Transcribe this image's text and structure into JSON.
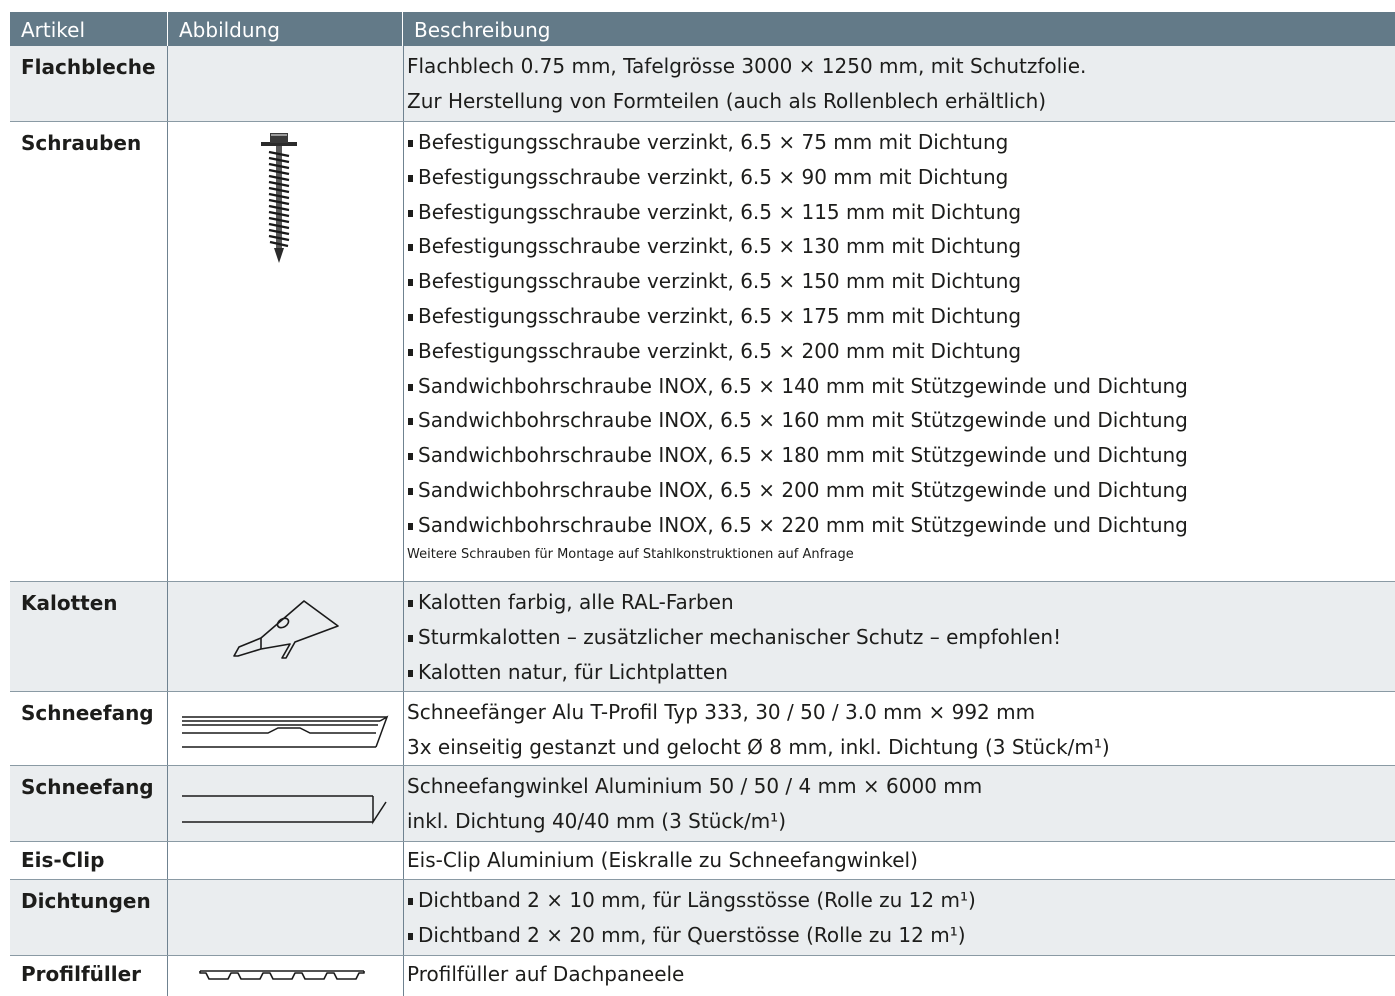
{
  "header": {
    "col1": "Artikel",
    "col2": "Abbildung",
    "col3": "Beschreibung"
  },
  "rows": [
    {
      "article": "Flachbleche",
      "icon": "",
      "lines": [
        "Flachblech 0.75 mm, Tafelgrösse 3000 × 1250 mm, mit Schutzfolie.",
        "Zur Herstellung von Formteilen (auch als Rollenblech erhältlich)"
      ]
    },
    {
      "article": "Schrauben",
      "icon": "screw-icon",
      "lines": [
        "Befestigungsschraube verzinkt, 6.5 ×   75 mm mit Dichtung",
        "Befestigungsschraube verzinkt, 6.5 ×   90 mm mit Dichtung",
        "Befestigungsschraube verzinkt, 6.5 × 115 mm mit Dichtung",
        "Befestigungsschraube verzinkt, 6.5 × 130 mm mit Dichtung",
        "Befestigungsschraube verzinkt, 6.5 × 150 mm mit Dichtung",
        "Befestigungsschraube verzinkt, 6.5 × 175 mm mit Dichtung",
        "Befestigungsschraube verzinkt, 6.5 × 200 mm mit Dichtung",
        "Sandwichbohrschraube INOX, 6.5 × 140 mm mit Stützgewinde und Dichtung",
        "Sandwichbohrschraube INOX, 6.5 × 160 mm mit Stützgewinde und Dichtung",
        "Sandwichbohrschraube INOX, 6.5 × 180 mm mit Stützgewinde und Dichtung",
        "Sandwichbohrschraube INOX, 6.5 × 200 mm mit Stützgewinde und Dichtung",
        "Sandwichbohrschraube INOX, 6.5 × 220 mm mit Stützgewinde und Dichtung"
      ],
      "note": "Weitere Schrauben für Montage auf Stahlkonstruktionen auf Anfrage"
    },
    {
      "article": "Kalotten",
      "icon": "cap-icon",
      "lines": [
        "Kalotten farbig, alle RAL-Farben",
        "Sturmkalotten – zusätzlicher mechanischer Schutz – empfohlen!",
        "Kalotten natur, für Lichtplatten"
      ]
    },
    {
      "article": "Schneefang",
      "icon": "t-profile-icon",
      "lines": [
        "Schneefänger Alu T-Profil Typ 333, 30 / 50 / 3.0 mm × 992 mm",
        "3x einseitig gestanzt und gelocht Ø 8 mm, inkl. Dichtung (3 Stück/m¹)"
      ]
    },
    {
      "article": "Schneefang",
      "icon": "angle-profile-icon",
      "lines": [
        "Schneefangwinkel Aluminium 50 / 50 / 4 mm × 6000 mm",
        "inkl. Dichtung 40/40 mm (3 Stück/m¹)"
      ]
    },
    {
      "article": "Eis-Clip",
      "icon": "",
      "lines": [
        "Eis-Clip Aluminium (Eiskralle zu Schneefangwinkel)"
      ]
    },
    {
      "article": "Dichtungen",
      "icon": "",
      "lines": [
        "Dichtband 2 × 10 mm, für Längsstösse (Rolle zu 12 m¹)",
        "Dichtband 2 × 20 mm, für Querstösse   (Rolle zu 12 m¹)"
      ]
    },
    {
      "article": "Profilfüller",
      "icon": "profile-filler-icon",
      "lines": [
        "Profilfüller auf Dachpaneele"
      ]
    }
  ]
}
